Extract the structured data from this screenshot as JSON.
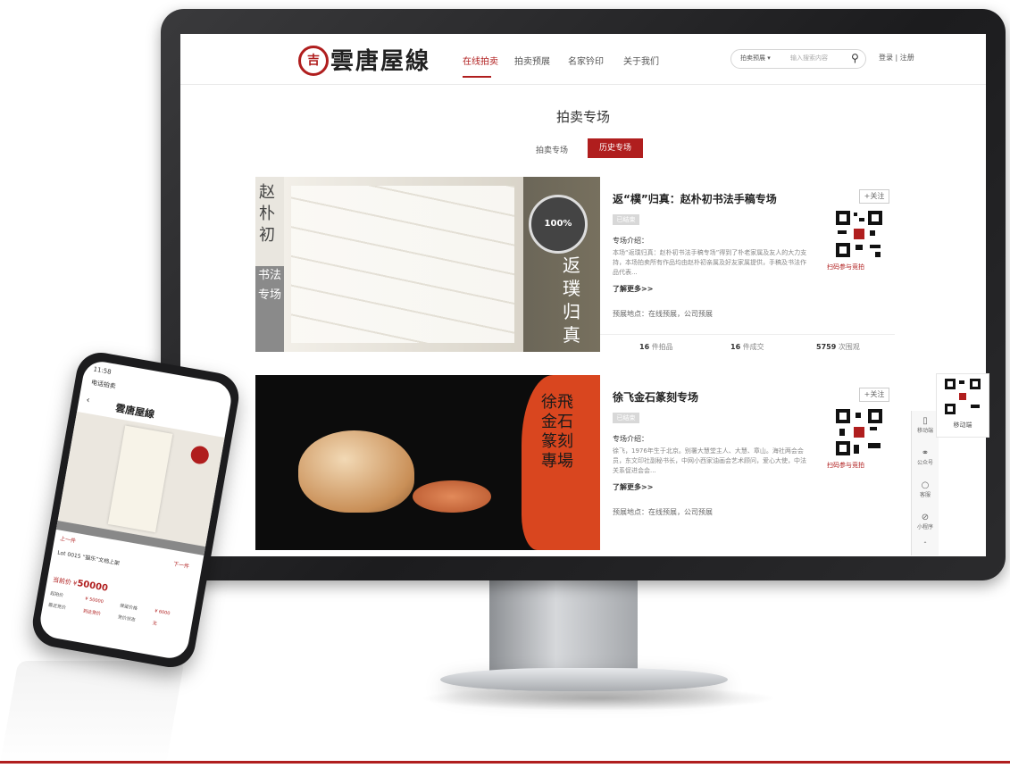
{
  "site": {
    "logo_mark": "吉",
    "logo_text": "雲唐屋線"
  },
  "nav": {
    "items": [
      "在线拍卖",
      "拍卖预展",
      "名家钤印",
      "关于我们"
    ],
    "search_scope": "拍卖预展 ▾",
    "search_placeholder": "输入搜索内容",
    "login": "登录 | 注册"
  },
  "page": {
    "title": "拍卖专场",
    "tabs": [
      "拍卖专场",
      "历史专场"
    ]
  },
  "cards": [
    {
      "image_text_left": "赵朴初",
      "image_text_left2": "书法专场",
      "image_text_right": "返璞归真",
      "image_stamp": "100%",
      "title": "返“樸”归真：赵朴初书法手稿专场",
      "follow": "+关注",
      "badge": "已结束",
      "intro_label": "专场介绍：",
      "intro": "本场“返璞归真：赵朴初书法手稿专场”得到了朴老家属及友人的大力支持，本场拍卖所有作品均由赵朴初亲属及好友家属提供，手稿及书法作品代表...",
      "more": "了解更多>>",
      "location": "预展地点：在线预展，公司预展",
      "qr_label": "扫码参与竞拍",
      "stats": [
        {
          "num": "16",
          "label": "件拍品"
        },
        {
          "num": "16",
          "label": "件成交"
        },
        {
          "num": "5759",
          "label": "次围观"
        }
      ]
    },
    {
      "image_text_right": "徐飛金石篆刻專場",
      "title": "徐飞金石篆刻专场",
      "follow": "+关注",
      "badge": "已结束",
      "intro_label": "专场介绍：",
      "intro": "徐飞，1976年生于北京。别署大慧堂主人、大慧、章山。海社两会会员，东文印社副秘书长，中网小西家油画会艺术顾问，爱心大使，中法关系促进会会...",
      "more": "了解更多>>",
      "location": "预展地点：在线预展，公司预展",
      "qr_label": "扫码参与竞拍"
    }
  ],
  "rail": {
    "items": [
      "移动端",
      "公众号",
      "客服",
      "小程序"
    ],
    "side_qr_label": "移动端"
  },
  "phone": {
    "status_time": "11:58",
    "app_title": "电话拍卖",
    "logo": "雲唐屋線",
    "prev": "上一件",
    "next": "下一件",
    "lot": "Lot 0015 “猫乐”文档上架",
    "price_label": "当前价 ¥",
    "price": "50000",
    "rows": [
      "起拍价",
      "¥ 50000",
      "保留价格",
      "¥ 6000",
      "最近竞价",
      "到达竞价",
      "竞价状态",
      "无"
    ]
  },
  "colors": {
    "accent": "#b01e1e",
    "monitor": "#2b2b2d"
  }
}
